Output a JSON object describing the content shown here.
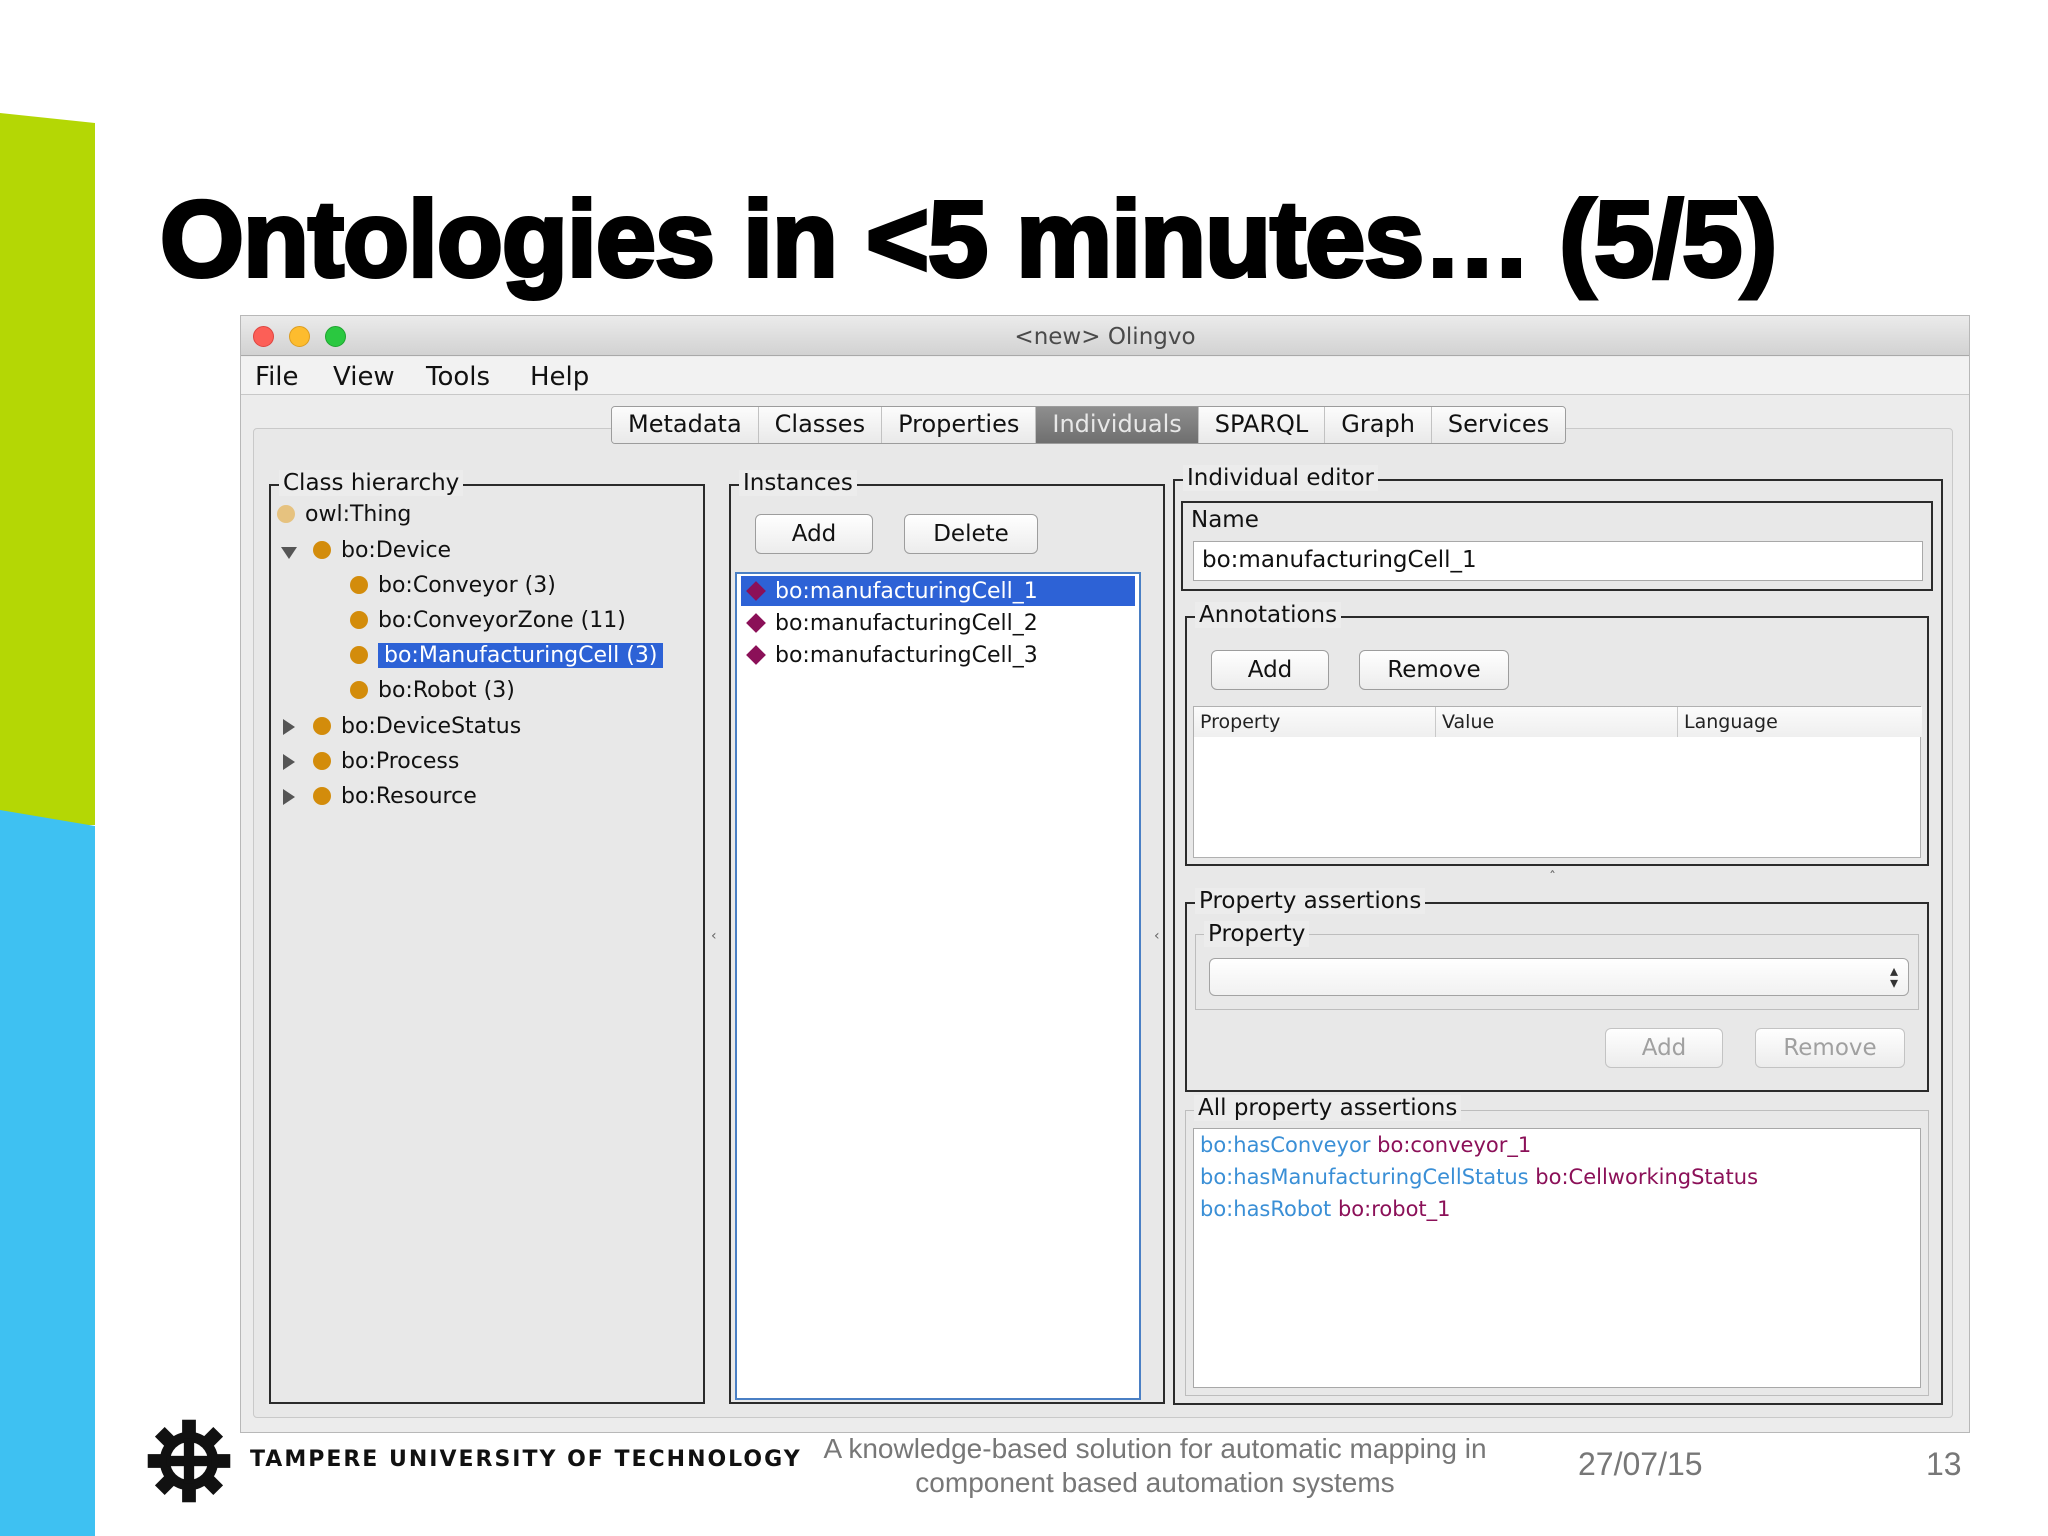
{
  "slide": {
    "title": "Ontologies in <5 minutes… (5/5)",
    "footer_org": "TAMPERE UNIVERSITY OF TECHNOLOGY",
    "footer_desc": "A knowledge-based solution for automatic mapping in component based automation systems",
    "footer_date": "27/07/15",
    "page_number": "13"
  },
  "window": {
    "title": "<new> Olingvo",
    "menu": [
      "File",
      "View",
      "Tools",
      "Help"
    ],
    "tabs": [
      "Metadata",
      "Classes",
      "Properties",
      "Individuals",
      "SPARQL",
      "Graph",
      "Services"
    ],
    "active_tab": "Individuals"
  },
  "class_hierarchy": {
    "legend": "Class hierarchy",
    "items": [
      {
        "label": "owl:Thing"
      },
      {
        "label": "bo:Device",
        "expanded": true
      },
      {
        "label": "bo:Conveyor (3)"
      },
      {
        "label": "bo:ConveyorZone (11)"
      },
      {
        "label": "bo:ManufacturingCell (3)",
        "selected": true
      },
      {
        "label": "bo:Robot (3)"
      },
      {
        "label": "bo:DeviceStatus",
        "expanded": false
      },
      {
        "label": "bo:Process",
        "expanded": false
      },
      {
        "label": "bo:Resource",
        "expanded": false
      }
    ]
  },
  "instances": {
    "legend": "Instances",
    "add_label": "Add",
    "delete_label": "Delete",
    "items": [
      {
        "label": "bo:manufacturingCell_1",
        "selected": true
      },
      {
        "label": "bo:manufacturingCell_2"
      },
      {
        "label": "bo:manufacturingCell_3"
      }
    ]
  },
  "individual_editor": {
    "legend": "Individual editor",
    "name_legend": "Name",
    "name_value": "bo:manufacturingCell_1",
    "annotations": {
      "legend": "Annotations",
      "add_label": "Add",
      "remove_label": "Remove",
      "columns": [
        "Property",
        "Value",
        "Language"
      ]
    },
    "property_assertions": {
      "legend": "Property assertions",
      "property_legend": "Property",
      "add_label": "Add",
      "remove_label": "Remove"
    },
    "all_property_assertions": {
      "legend": "All property assertions",
      "rows": [
        {
          "property": "bo:hasConveyor",
          "value": "bo:conveyor_1"
        },
        {
          "property": "bo:hasManufacturingCellStatus",
          "value": "bo:CellworkingStatus"
        },
        {
          "property": "bo:hasRobot",
          "value": "bo:robot_1"
        }
      ]
    }
  },
  "colors": {
    "accent_green": "#b4d705",
    "accent_blue": "#3ec1f2",
    "selection": "#2d62d6",
    "property_link": "#3a8fd6",
    "individual_value": "#8b1058"
  }
}
